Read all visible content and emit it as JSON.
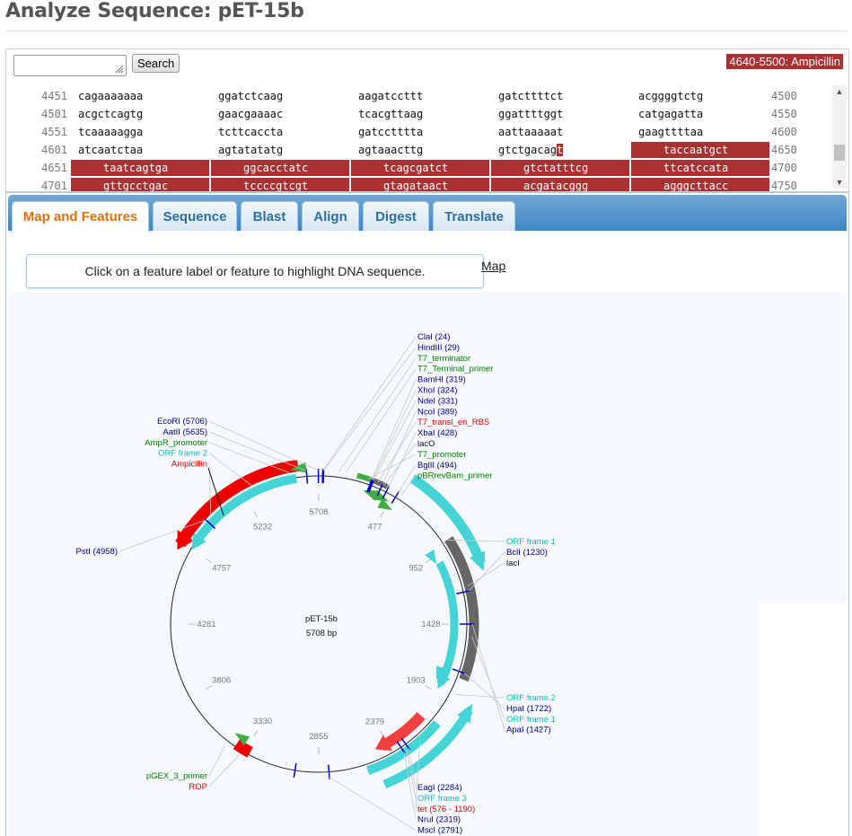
{
  "page": {
    "title": "Analyze Sequence: pET-15b"
  },
  "search": {
    "value": "",
    "button_label": "Search"
  },
  "range_label": "4640-5500: Ampicillin",
  "sequence": {
    "rows": [
      {
        "start": "4451",
        "blocks": [
          "cagaaaaaaa",
          "ggatctcaag",
          "aagatccttt",
          "gatcttttct",
          "acggggtctg"
        ],
        "end": "4500"
      },
      {
        "start": "4501",
        "blocks": [
          "acgctcagtg",
          "gaacgaaaac",
          "tcacgttaag",
          "ggattttggt",
          "catgagatta"
        ],
        "end": "4550"
      },
      {
        "start": "4551",
        "blocks": [
          "tcaaaaagga",
          "tcttcaccta",
          "gatcctttta",
          "aattaaaaat",
          "gaagttttaa"
        ],
        "end": "4600"
      },
      {
        "start": "4601",
        "blocks": [
          "atcaatctaa",
          "agtatatatg",
          "agtaaacttg",
          "gtctgacagt",
          "taccaatgct"
        ],
        "end": "4650"
      },
      {
        "start": "4651",
        "blocks": [
          "taatcagtga",
          "ggcacctatc",
          "tcagcgatct",
          "gtctatttcg",
          "ttcatccata"
        ],
        "end": "4700"
      },
      {
        "start": "4701",
        "blocks": [
          "gttgcctgac",
          "tccccgtcgt",
          "gtagataact",
          "acgatacggg",
          "agggcttacc"
        ],
        "end": "4750"
      }
    ]
  },
  "tabs": [
    "Map and Features",
    "Sequence",
    "Blast",
    "Align",
    "Digest",
    "Translate"
  ],
  "active_tab": "Map and Features",
  "map": {
    "tooltip": "Click on a feature label or feature to highlight DNA sequence.",
    "link": "Map",
    "name": "pET-15b",
    "length": "5708 bp",
    "ticks": [
      "5708",
      "477",
      "952",
      "1428",
      "1903",
      "2379",
      "2855",
      "3330",
      "3806",
      "4281",
      "4757",
      "5232"
    ],
    "labels_top": [
      {
        "text": "ClaI (24)",
        "color": "#00008b"
      },
      {
        "text": "HindIII (29)",
        "color": "#00008b"
      },
      {
        "text": "T7_terminator",
        "color": "#008000"
      },
      {
        "text": "T7_Terminal_primer",
        "color": "#008000"
      },
      {
        "text": "BamHI (319)",
        "color": "#00008b"
      },
      {
        "text": "XhoI (324)",
        "color": "#00008b"
      },
      {
        "text": "NdeI (331)",
        "color": "#00008b"
      },
      {
        "text": "NcoI (389)",
        "color": "#00008b"
      },
      {
        "text": "T7_transl_en_RBS",
        "color": "#e00000"
      },
      {
        "text": "XbaI (428)",
        "color": "#00008b"
      },
      {
        "text": "lacO",
        "color": "#111111"
      },
      {
        "text": "T7_promoter",
        "color": "#008000"
      },
      {
        "text": "BglII (494)",
        "color": "#00008b"
      },
      {
        "text": "pBRrevBam_primer",
        "color": "#008000"
      }
    ],
    "labels_left_top": [
      {
        "text": "EcoRI (5706)",
        "color": "#00008b"
      },
      {
        "text": "AatII (5635)",
        "color": "#00008b"
      },
      {
        "text": "AmpR_promoter",
        "color": "#008000"
      },
      {
        "text": "ORF frame 2",
        "color": "#14b8b8"
      },
      {
        "text": "Ampicillin",
        "color": "#e00000"
      }
    ],
    "labels_right_mid": [
      {
        "text": "ORF frame 1",
        "color": "#14b8b8"
      },
      {
        "text": "BclI (1230)",
        "color": "#00008b"
      },
      {
        "text": "lacI",
        "color": "#111111"
      }
    ],
    "labels_right_low": [
      {
        "text": "ORF frame 2",
        "color": "#14b8b8"
      },
      {
        "text": "HpaI (1722)",
        "color": "#00008b"
      },
      {
        "text": "ORF frame 1",
        "color": "#14b8b8"
      },
      {
        "text": "ApaI (1427)",
        "color": "#00008b"
      }
    ],
    "labels_bottom": [
      {
        "text": "EagI (2284)",
        "color": "#00008b"
      },
      {
        "text": "ORF frame 3",
        "color": "#14b8b8"
      },
      {
        "text": "tet (576 - 1190)",
        "color": "#e00000"
      },
      {
        "text": "NruI (2319)",
        "color": "#00008b"
      },
      {
        "text": "MscI (2791)",
        "color": "#00008b"
      }
    ],
    "label_pst": {
      "text": "PstI (4958)",
      "color": "#00008b"
    },
    "labels_left_bottom": [
      {
        "text": "pGEX_3_primer",
        "color": "#008000"
      },
      {
        "text": "ROP",
        "color": "#e00000"
      }
    ],
    "colors": {
      "ampicillin": "#ee0000",
      "orf": "#44d3d6",
      "laci": "#666666",
      "tet": "#f04040",
      "promoter": "#44aa44",
      "site": "#0000cc"
    }
  }
}
